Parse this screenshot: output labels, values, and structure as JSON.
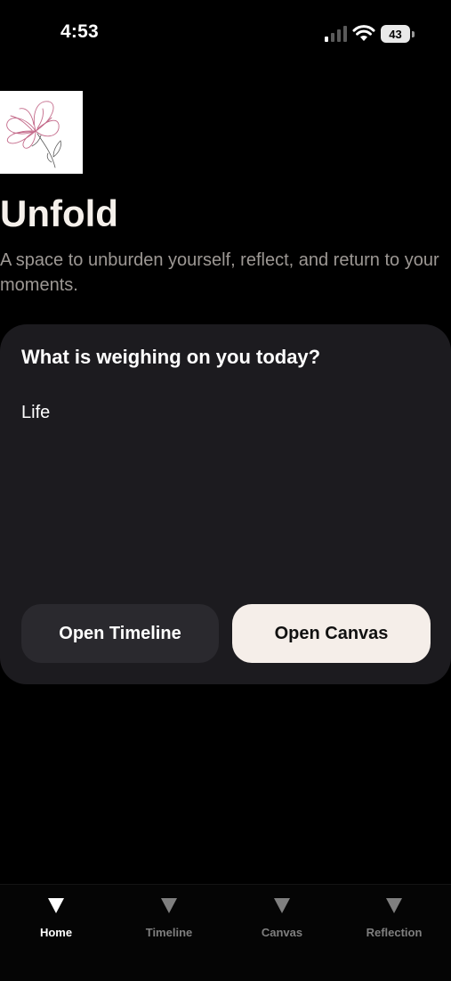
{
  "status_bar": {
    "time": "4:53",
    "battery": "43"
  },
  "header": {
    "title": "Unfold",
    "subtitle": "A space to unburden yourself, reflect, and return to your moments.",
    "logo_icon": "flower-sketch-icon"
  },
  "prompt_card": {
    "question": "What is weighing on you today?",
    "input_value": "Life",
    "buttons": {
      "timeline_label": "Open Timeline",
      "canvas_label": "Open Canvas"
    }
  },
  "tab_bar": {
    "active": "Home",
    "items": [
      {
        "label": "Home",
        "icon": "triangle-down-icon"
      },
      {
        "label": "Timeline",
        "icon": "triangle-down-icon"
      },
      {
        "label": "Canvas",
        "icon": "triangle-down-icon"
      },
      {
        "label": "Reflection",
        "icon": "triangle-down-icon"
      }
    ]
  },
  "colors": {
    "background": "#000000",
    "card": "#1c1b1f",
    "secondary_button": "#2a292e",
    "primary_button": "#f5eee9",
    "title_text": "#f5f0eb",
    "subtitle_text": "#9d9894",
    "inactive_tab": "#7f7f7f",
    "sketch_pink": "#c46a8a"
  }
}
